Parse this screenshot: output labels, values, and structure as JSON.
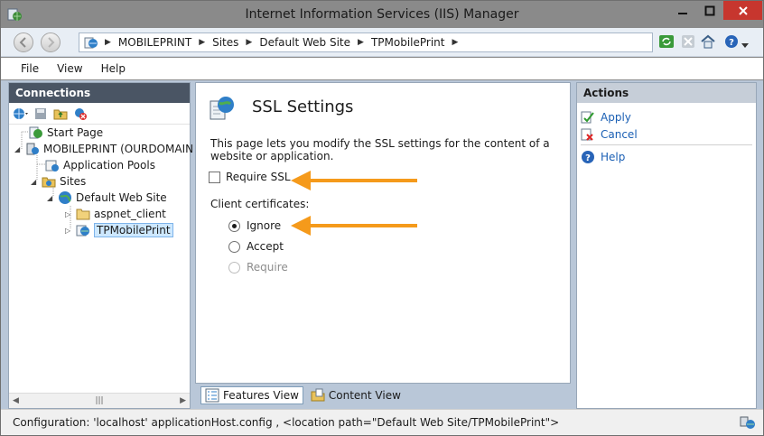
{
  "window": {
    "title": "Internet Information Services (IIS) Manager",
    "colors": {
      "close": "#c7362e",
      "frame": "#8a8a8a"
    }
  },
  "breadcrumb": [
    "MOBILEPRINT",
    "Sites",
    "Default Web Site",
    "TPMobilePrint"
  ],
  "menu": [
    "File",
    "View",
    "Help"
  ],
  "connections": {
    "header": "Connections",
    "tree": [
      {
        "label": "Start Page",
        "icon": "start-page-icon"
      },
      {
        "label": "MOBILEPRINT (OURDOMAIN",
        "icon": "server-icon"
      },
      {
        "label": "Application Pools",
        "icon": "app-pools-icon"
      },
      {
        "label": "Sites",
        "icon": "sites-folder-icon"
      },
      {
        "label": "Default Web Site",
        "icon": "globe-icon"
      },
      {
        "label": "aspnet_client",
        "icon": "folder-icon"
      },
      {
        "label": "TPMobilePrint",
        "icon": "web-app-icon"
      }
    ]
  },
  "ssl": {
    "title": "SSL Settings",
    "description": "This page lets you modify the SSL settings for the content of a website or application.",
    "require_ssl_label": "Require SSL",
    "require_ssl_checked": false,
    "client_cert_label": "Client certificates:",
    "options": [
      {
        "label": "Ignore",
        "checked": true,
        "enabled": true
      },
      {
        "label": "Accept",
        "checked": false,
        "enabled": true
      },
      {
        "label": "Require",
        "checked": false,
        "enabled": false
      }
    ],
    "callout_color": "#f59a1b"
  },
  "view_tabs": {
    "features": "Features View",
    "content": "Content View"
  },
  "actions": {
    "header": "Actions",
    "apply": "Apply",
    "cancel": "Cancel",
    "help": "Help"
  },
  "status": "Configuration: 'localhost' applicationHost.config , <location path=\"Default Web Site/TPMobilePrint\">"
}
